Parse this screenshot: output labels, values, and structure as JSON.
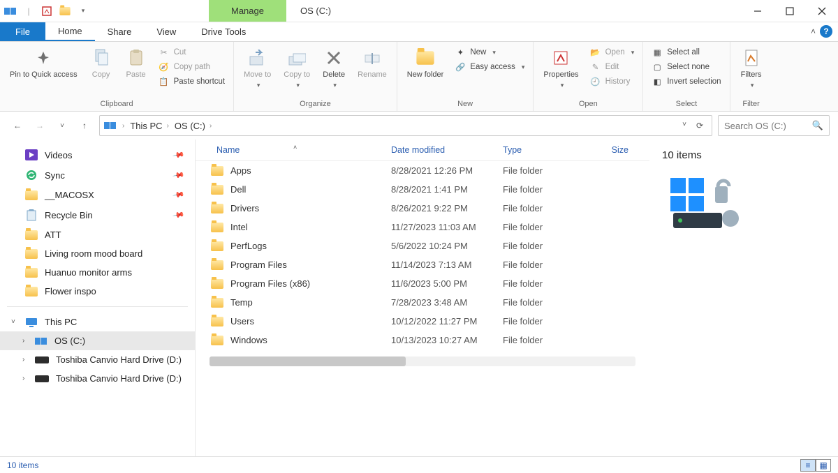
{
  "window": {
    "title": "OS (C:)",
    "context_tab": "Manage"
  },
  "tabs": {
    "file": "File",
    "home": "Home",
    "share": "Share",
    "view": "View",
    "drive_tools": "Drive Tools"
  },
  "ribbon": {
    "clipboard": {
      "label": "Clipboard",
      "pin": "Pin to Quick access",
      "copy": "Copy",
      "paste": "Paste",
      "cut": "Cut",
      "copy_path": "Copy path",
      "paste_shortcut": "Paste shortcut"
    },
    "organize": {
      "label": "Organize",
      "move_to": "Move to",
      "copy_to": "Copy to",
      "delete": "Delete",
      "rename": "Rename"
    },
    "new": {
      "label": "New",
      "new_folder": "New folder",
      "new_item": "New",
      "easy_access": "Easy access"
    },
    "open": {
      "label": "Open",
      "properties": "Properties",
      "open": "Open",
      "edit": "Edit",
      "history": "History"
    },
    "select": {
      "label": "Select",
      "select_all": "Select all",
      "select_none": "Select none",
      "invert": "Invert selection"
    },
    "filter": {
      "label": "Filter",
      "filters": "Filters"
    }
  },
  "breadcrumb": {
    "root": "This PC",
    "drive": "OS (C:)"
  },
  "search": {
    "placeholder": "Search OS (C:)"
  },
  "sidebar": {
    "quick": [
      {
        "label": "Videos",
        "kind": "videos",
        "pinned": true
      },
      {
        "label": "Sync",
        "kind": "sync",
        "pinned": true
      },
      {
        "label": "__MACOSX",
        "kind": "folder",
        "pinned": true
      },
      {
        "label": "Recycle Bin",
        "kind": "recycle",
        "pinned": true
      },
      {
        "label": "ATT",
        "kind": "folder"
      },
      {
        "label": "Living room mood board",
        "kind": "folder"
      },
      {
        "label": "Huanuo monitor arms",
        "kind": "folder"
      },
      {
        "label": "Flower inspo",
        "kind": "folder"
      }
    ],
    "this_pc": "This PC",
    "drives": [
      {
        "label": "OS (C:)",
        "selected": true,
        "kind": "os"
      },
      {
        "label": "Toshiba Canvio Hard Drive (D:)",
        "kind": "hdd"
      },
      {
        "label": "Toshiba Canvio Hard Drive (D:)",
        "kind": "hdd"
      }
    ]
  },
  "columns": {
    "name": "Name",
    "date": "Date modified",
    "type": "Type",
    "size": "Size"
  },
  "rows": [
    {
      "name": "Apps",
      "date": "8/28/2021 12:26 PM",
      "type": "File folder"
    },
    {
      "name": "Dell",
      "date": "8/28/2021 1:41 PM",
      "type": "File folder"
    },
    {
      "name": "Drivers",
      "date": "8/26/2021 9:22 PM",
      "type": "File folder"
    },
    {
      "name": "Intel",
      "date": "11/27/2023 11:03 AM",
      "type": "File folder"
    },
    {
      "name": "PerfLogs",
      "date": "5/6/2022 10:24 PM",
      "type": "File folder"
    },
    {
      "name": "Program Files",
      "date": "11/14/2023 7:13 AM",
      "type": "File folder"
    },
    {
      "name": "Program Files (x86)",
      "date": "11/6/2023 5:00 PM",
      "type": "File folder"
    },
    {
      "name": "Temp",
      "date": "7/28/2023 3:48 AM",
      "type": "File folder"
    },
    {
      "name": "Users",
      "date": "10/12/2022 11:27 PM",
      "type": "File folder"
    },
    {
      "name": "Windows",
      "date": "10/13/2023 10:27 AM",
      "type": "File folder"
    }
  ],
  "details": {
    "count_label": "10 items"
  },
  "status": {
    "left": "10 items"
  }
}
